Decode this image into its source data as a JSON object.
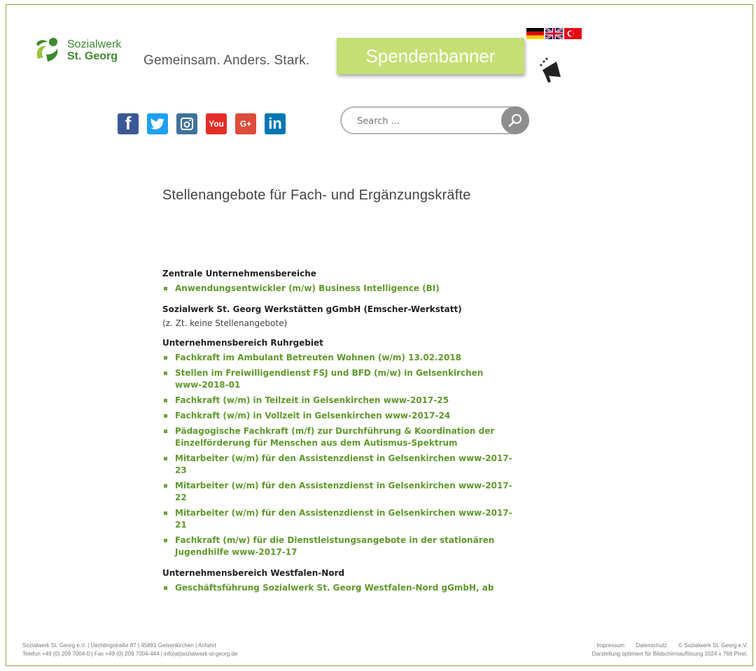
{
  "header": {
    "logo_line1": "Sozialwerk",
    "logo_line2": "St. Georg",
    "tagline": "Gemeinsam. Anders. Stark.",
    "donate_label": "Spendenbanner",
    "flags": [
      "german-flag",
      "uk-flag",
      "turkish-flag"
    ],
    "brand_color": "#3b8a2e",
    "donate_color": "#c6df74"
  },
  "social": {
    "icons": [
      "facebook-icon",
      "twitter-icon",
      "instagram-icon",
      "youtube-icon",
      "google-plus-icon",
      "linkedin-icon"
    ],
    "fb_glyph": "f",
    "yt_glyph": "You",
    "gp_glyph": "G+",
    "li_glyph": "in"
  },
  "search": {
    "placeholder": "Search ..."
  },
  "main": {
    "title": "Stellenangebote für Fach- und Ergänzungskräfte",
    "sections": [
      {
        "heading": "Zentrale Unternehmensbereiche",
        "jobs": [
          "Anwendungsentwickler (m/w) Business Intelligence (BI)"
        ]
      },
      {
        "heading": "Sozialwerk St. Georg Werkstätten gGmbH (Emscher-Werkstatt)",
        "note": "(z. Zt. keine Stellenangebote)"
      },
      {
        "heading": "Unternehmensbereich Ruhrgebiet",
        "jobs": [
          "Fachkraft im Ambulant Betreuten Wohnen (w/m) 13.02.2018",
          "Stellen im Freiwilligendienst FSJ und BFD (m/w) in Gelsenkirchen www-2018-01",
          "Fachkraft (w/m) in Teilzeit in Gelsenkirchen www-2017-25",
          "Fachkraft (w/m) in Vollzeit in Gelsenkirchen www-2017-24",
          "Pädagogische Fachkraft (m/f) zur Durchführung & Koordination der Einzelförderung für Menschen aus dem Autismus-Spektrum",
          "Mitarbeiter (w/m) für den Assistenzdienst in Gelsenkirchen www-2017-23",
          "Mitarbeiter (w/m) für den Assistenzdienst in Gelsenkirchen www-2017-22",
          "Mitarbeiter (w/m) für den Assistenzdienst in Gelsenkirchen www-2017-21",
          "Fachkraft (m/w) für die Dienstleistungsangebote in der stationären Jugendhilfe www-2017-17"
        ]
      },
      {
        "heading": "Unternehmensbereich Westfalen-Nord",
        "jobs": [
          "Geschäftsführung Sozialwerk St. Georg Westfalen-Nord gGmbH, ab"
        ]
      }
    ]
  },
  "footer": {
    "address": "Sozialwerk St. Georg e.V. | Uechtingstraße 87 | 45881 Gelsenkirchen | Anfahrt",
    "contact": "Telefon +49 (0) 209 7004-0 | Fax +49 (0) 209 7004-444 | info(at)sozialwerk-st-georg.de",
    "imprint": "Impressum",
    "privacy": "Datenschutz",
    "copyright": "© Sozialwerk St. Georg e.V.",
    "resolution_note": "Darstellung optimiert für Bildschirmauflösung 1024 x 768 Pixel."
  }
}
